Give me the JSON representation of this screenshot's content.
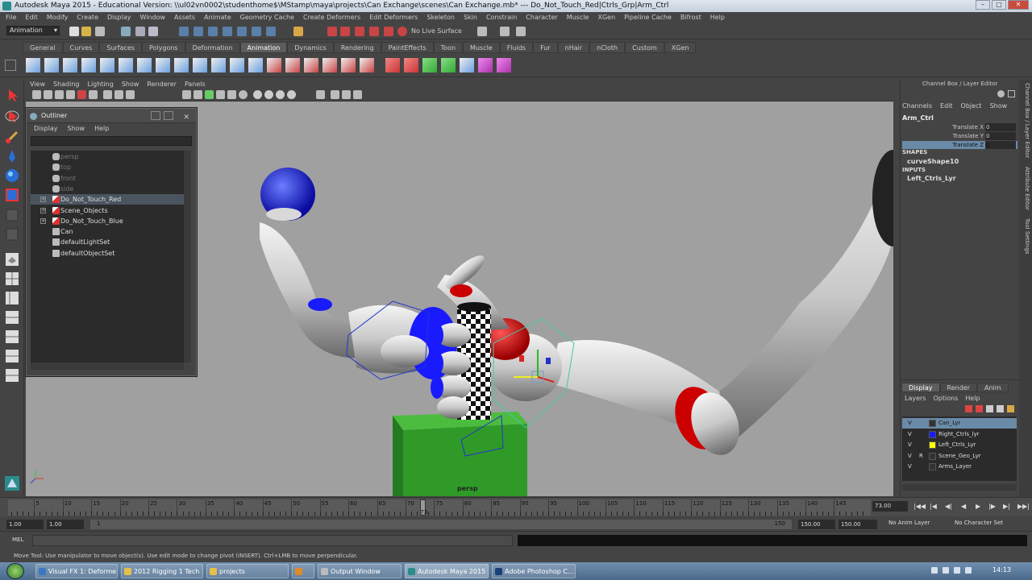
{
  "titlebar": {
    "title": "Autodesk Maya 2015 - Educational Version: \\\\ul02vn0002\\studenthome$\\MStamp\\maya\\projects\\Can Exchange\\scenes\\Can Exchange.mb*  ---  Do_Not_Touch_Red|Ctrls_Grp|Arm_Ctrl"
  },
  "menubar": {
    "items": [
      "File",
      "Edit",
      "Modify",
      "Create",
      "Display",
      "Window",
      "Assets",
      "Animate",
      "Geometry Cache",
      "Create Deformers",
      "Edit Deformers",
      "Skeleton",
      "Skin",
      "Constrain",
      "Character",
      "Muscle",
      "XGen",
      "Pipeline Cache",
      "Bifrost",
      "Help"
    ]
  },
  "statusline": {
    "mode": "Animation",
    "live_surface": "No Live Surface"
  },
  "shelf": {
    "tabs": [
      "General",
      "Curves",
      "Surfaces",
      "Polygons",
      "Deformation",
      "Animation",
      "Dynamics",
      "Rendering",
      "PaintEffects",
      "Toon",
      "Muscle",
      "Fluids",
      "Fur",
      "nHair",
      "nCloth",
      "Custom",
      "XGen"
    ],
    "active_index": 5
  },
  "panel": {
    "menus": [
      "View",
      "Shading",
      "Lighting",
      "Show",
      "Renderer",
      "Panels"
    ],
    "camera_label": "persp"
  },
  "outliner": {
    "title": "Outliner",
    "menus": [
      "Display",
      "Show",
      "Help"
    ],
    "items": [
      {
        "label": "persp",
        "dim": true
      },
      {
        "label": "top",
        "dim": true
      },
      {
        "label": "front",
        "dim": true
      },
      {
        "label": "side",
        "dim": true
      },
      {
        "label": "Do_Not_Touch_Red",
        "expandable": true,
        "selected": true
      },
      {
        "label": "Scene_Objects",
        "expandable": true
      },
      {
        "label": "Do_Not_Touch_Blue",
        "expandable": true
      },
      {
        "label": "Can"
      },
      {
        "label": "defaultLightSet"
      },
      {
        "label": "defaultObjectSet"
      }
    ]
  },
  "channel_box": {
    "header": "Channel Box / Layer Editor",
    "menus": [
      "Channels",
      "Edit",
      "Object",
      "Show"
    ],
    "object": "Arm_Ctrl",
    "attributes": [
      {
        "name": "Translate X",
        "value": "0"
      },
      {
        "name": "Translate Y",
        "value": "0"
      },
      {
        "name": "Translate Z",
        "value": "0"
      }
    ],
    "shapes_label": "SHAPES",
    "shape": "curveShape10",
    "inputs_label": "INPUTS",
    "input": "Left_Ctrls_Lyr"
  },
  "side_tabs": [
    "Channel Box / Layer Editor",
    "Attribute Editor",
    "Tool Settings"
  ],
  "layer_editor": {
    "tabs": [
      "Display",
      "Render",
      "Anim"
    ],
    "menus": [
      "Layers",
      "Options",
      "Help"
    ],
    "layers": [
      {
        "v": "V",
        "p": "",
        "name": "Can_Lyr",
        "color": "#333333"
      },
      {
        "v": "V",
        "p": "",
        "name": "Right_Ctrls_lyr",
        "color": "#1a1aff"
      },
      {
        "v": "V",
        "p": "",
        "name": "Left_Ctrls_Lyr",
        "color": "#ffff00"
      },
      {
        "v": "V",
        "p": "R",
        "name": "Scene_Geo_Lyr",
        "color": "#333333"
      },
      {
        "v": "V",
        "p": "",
        "name": "Arms_Layer",
        "color": "#333333"
      }
    ]
  },
  "timeline": {
    "labels": [
      "5",
      "10",
      "15",
      "20",
      "25",
      "30",
      "35",
      "40",
      "45",
      "50",
      "55",
      "60",
      "65",
      "70",
      "75",
      "80",
      "85",
      "90",
      "95",
      "100",
      "105",
      "110",
      "115",
      "120",
      "125",
      "130",
      "135",
      "140",
      "145"
    ],
    "current_frame": "73",
    "current_frame_field": "73.00"
  },
  "range": {
    "start": "1.00",
    "start2": "1.00",
    "slider_start": "1",
    "slider_end": "150",
    "end": "150.00",
    "end2": "150.00",
    "anim_layer": "No Anim Layer",
    "character_set": "No Character Set"
  },
  "mel": {
    "label": "MEL"
  },
  "help": {
    "text": "Move Tool: Use manipulator to move object(s). Use edit mode to change pivot (INSERT). Ctrl+LMB to move perpendicular."
  },
  "taskbar": {
    "tasks": [
      {
        "label": "Visual FX 1: Deforme...",
        "color": "#3b78c4",
        "active": false
      },
      {
        "label": "2012 Rigging 1 Tech ...",
        "color": "#e4c04a",
        "active": false
      },
      {
        "label": "projects",
        "color": "#e4c04a",
        "active": false
      },
      {
        "label": "",
        "color": "#e08a2a",
        "active": false
      },
      {
        "label": "Output Window",
        "color": "#bbbbbb",
        "active": false
      },
      {
        "label": "Autodesk Maya 2015 ...",
        "color": "#2b8c8c",
        "active": true
      },
      {
        "label": "Adobe Photoshop C...",
        "color": "#1b3f7a",
        "active": false
      }
    ],
    "clock": "14:13"
  }
}
